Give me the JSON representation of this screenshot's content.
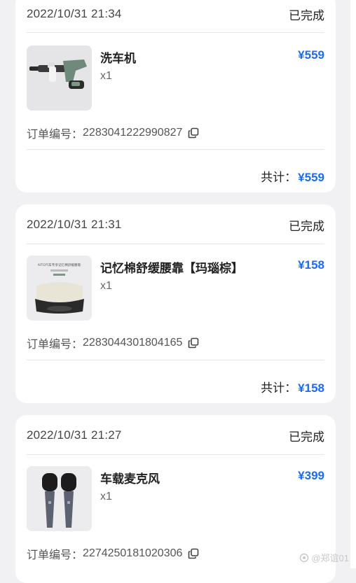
{
  "orders": [
    {
      "date": "2022/10/31 21:34",
      "status": "已完成",
      "product_name": "洗车机",
      "quantity": "x1",
      "price": "¥559",
      "order_label": "订单编号：",
      "order_number": "2283041222990827",
      "total_label": "共计：",
      "total_amount": "¥559",
      "image_icon": "car-washer-gun-icon"
    },
    {
      "date": "2022/10/31 21:31",
      "status": "已完成",
      "product_name": "记忆棉舒缓腰靠【玛瑙棕】",
      "quantity": "x1",
      "price": "¥158",
      "order_label": "订单编号：",
      "order_number": "2283044301804165",
      "total_label": "共计：",
      "total_amount": "¥158",
      "image_icon": "lumbar-pillow-icon",
      "image_caption": "AITO汽车专享记忆棉舒缓腰靠"
    },
    {
      "date": "2022/10/31 21:27",
      "status": "已完成",
      "product_name": "车载麦克风",
      "quantity": "x1",
      "price": "¥399",
      "order_label": "订单编号：",
      "order_number": "2274250181020306",
      "image_icon": "microphone-pair-icon"
    }
  ],
  "watermark": "@郑谊01",
  "colors": {
    "accent": "#1a6cf0",
    "background": "#f1f1f3",
    "card": "#ffffff"
  }
}
